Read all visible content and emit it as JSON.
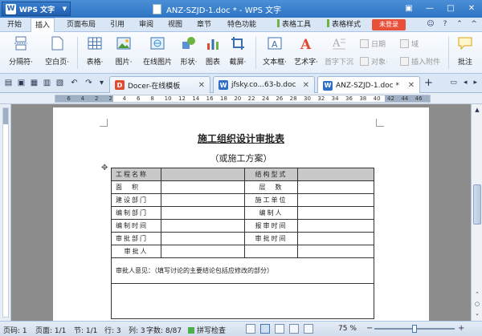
{
  "app": {
    "name": "WPS 文字",
    "logo": "W"
  },
  "window": {
    "title": "ANZ-SZJD-1.doc * - WPS 文字"
  },
  "menu": {
    "items": [
      "开始",
      "插入",
      "页面布局",
      "引用",
      "审阅",
      "视图",
      "章节",
      "特色功能"
    ],
    "active": "插入",
    "tool_tabs": [
      "表格工具",
      "表格样式"
    ],
    "login": "未登录"
  },
  "ribbon": {
    "buttons": [
      {
        "label": "分隔符·",
        "icon": "page-break-icon"
      },
      {
        "label": "空白页·",
        "icon": "blank-page-icon"
      },
      {
        "label": "表格·",
        "icon": "table-icon"
      },
      {
        "label": "图片·",
        "icon": "picture-icon"
      },
      {
        "label": "在线图片",
        "icon": "online-picture-icon"
      },
      {
        "label": "形状·",
        "icon": "shapes-icon"
      },
      {
        "label": "图表",
        "icon": "chart-icon"
      },
      {
        "label": "截屏·",
        "icon": "screenshot-icon"
      },
      {
        "label": "文本框·",
        "icon": "textbox-icon"
      },
      {
        "label": "艺术字·",
        "icon": "wordart-icon"
      },
      {
        "label": "首字下沉",
        "icon": "drop-cap-icon"
      },
      {
        "label": "批注",
        "icon": "comment-icon"
      }
    ],
    "small_buttons": [
      "日期",
      "域",
      "对象·",
      "插入附件"
    ]
  },
  "doc_tabs": [
    {
      "label": "Docer-在线模板",
      "icon": "D",
      "color": "#e04a2f"
    },
    {
      "label": "jfsky.co...63-b.doc",
      "icon": "W",
      "color": "#2f6fc6"
    },
    {
      "label": "ANZ-SZJD-1.doc *",
      "icon": "W",
      "color": "#2f6fc6"
    }
  ],
  "ruler": {
    "numbers": [
      "6",
      "4",
      "2",
      "2",
      "4",
      "6",
      "8",
      "10",
      "12",
      "14",
      "16",
      "18",
      "20",
      "22",
      "24",
      "26",
      "28",
      "30",
      "32",
      "34",
      "36",
      "38",
      "40",
      "42",
      "44",
      "46"
    ]
  },
  "document": {
    "title": "施工组织设计审批表",
    "subtitle": "（或施工方案）",
    "rows": [
      [
        "工程名称",
        "",
        "结构型式",
        ""
      ],
      [
        "面　积",
        "",
        "层　数",
        ""
      ],
      [
        "建设部门",
        "",
        "施工单位",
        ""
      ],
      [
        "编制部门",
        "",
        "编制人",
        ""
      ],
      [
        "编制时间",
        "",
        "报审时间",
        ""
      ],
      [
        "审批部门",
        "",
        "审批时间",
        ""
      ],
      [
        "审批人",
        "",
        "",
        ""
      ]
    ],
    "opinion": "审批人意见：（填写讨论的主要结论包括应修改的部分）"
  },
  "status": {
    "page_code": "页码: 1",
    "page": "页面: 1/1",
    "section": "节: 1/1",
    "row_col": "行: 3",
    "col": "列: 3",
    "words": "字数: 8/87",
    "spell": "拼写检查",
    "zoom": "75 %",
    "zoom_level": 0.5
  }
}
